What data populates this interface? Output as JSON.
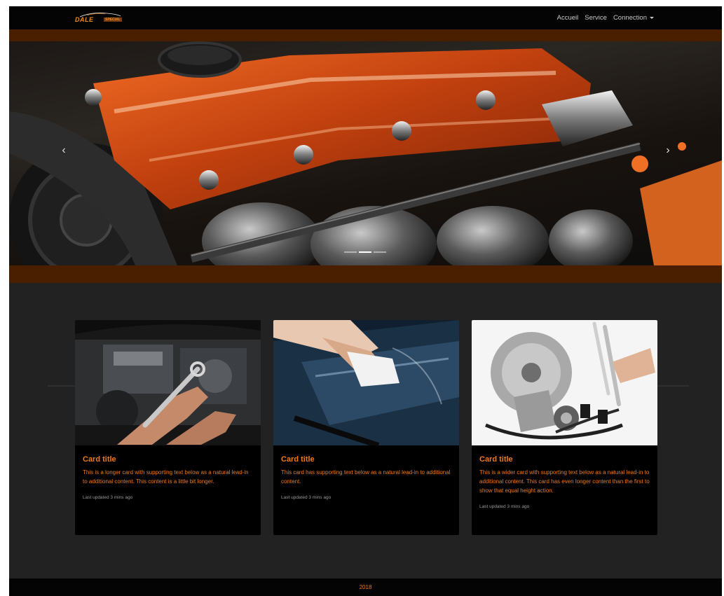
{
  "brand": {
    "name": "DALE",
    "tag": "SPECIAL"
  },
  "nav": {
    "links": [
      {
        "label": "Accueil"
      },
      {
        "label": "Service"
      },
      {
        "label": "Connection"
      }
    ]
  },
  "carousel": {
    "prev_icon": "chevron-left-icon",
    "next_icon": "chevron-right-icon",
    "prev_glyph": "‹",
    "next_glyph": "›",
    "slide_count": 3,
    "active_index": 1
  },
  "cards": [
    {
      "title": "Card title",
      "text": "This is a longer card with supporting text below as a natural lead-in to additional content. This content is a little bit longer.",
      "meta": "Last updated 3 mins ago"
    },
    {
      "title": "Card title",
      "text": "This card has supporting text below as a natural lead-in to additional content.",
      "meta": "Last updated 3 mins ago"
    },
    {
      "title": "Card title",
      "text": "This is a wider card with supporting text below as a natural lead-in to additional content. This card has even longer content than the first to show that equal height action.",
      "meta": "Last updated 3 mins ago"
    }
  ],
  "footer": {
    "text": "2018"
  },
  "colors": {
    "accent": "#ee7a16",
    "navbar": "#040404",
    "page_bg": "#222222",
    "hero_band": "#4a1f00",
    "card_bg": "#000000"
  }
}
